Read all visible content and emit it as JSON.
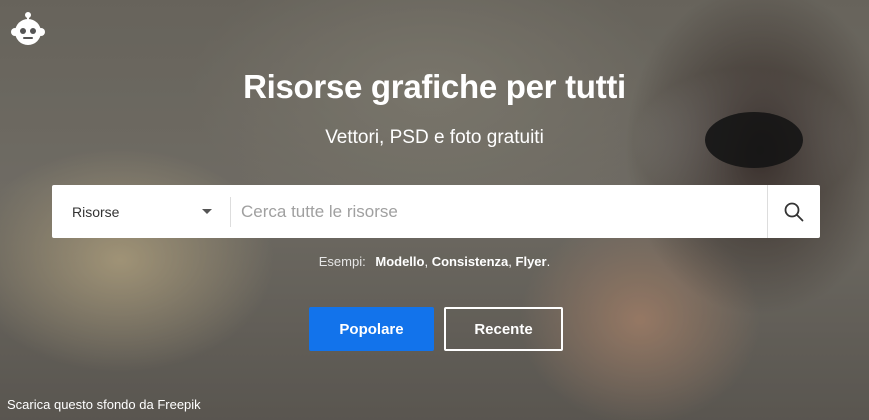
{
  "hero": {
    "title": "Risorse grafiche per tutti",
    "subtitle": "Vettori, PSD e foto gratuiti"
  },
  "search": {
    "category_selected": "Risorse",
    "placeholder": "Cerca tutte le risorse"
  },
  "examples": {
    "label": "Esempi:",
    "items": [
      "Modello",
      "Consistenza",
      "Flyer"
    ]
  },
  "buttons": {
    "popular": "Popolare",
    "recent": "Recente"
  },
  "credit": "Scarica questo sfondo da Freepik",
  "colors": {
    "accent": "#1273eb",
    "text_on_image": "#ffffff"
  },
  "icons": [
    "freepik-logo-icon",
    "chevron-down-icon",
    "search-icon"
  ]
}
